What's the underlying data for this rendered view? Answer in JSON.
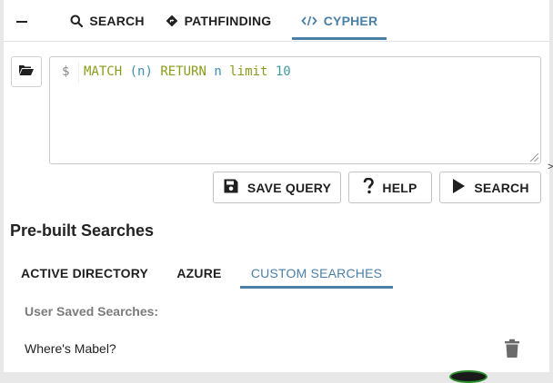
{
  "top_tabs": [
    {
      "label": "SEARCH",
      "icon": "search-icon"
    },
    {
      "label": "PATHFINDING",
      "icon": "diamond-route-icon"
    },
    {
      "label": "CYPHER",
      "icon": "code-icon",
      "active": true
    }
  ],
  "collapse_icon": "minus-icon",
  "editor": {
    "prompt": "$",
    "query": {
      "match": "MATCH",
      "open_paren": "(",
      "var1": "n",
      "close_paren": ")",
      "return": "RETURN",
      "var2": "n",
      "limit": "limit",
      "number": "10"
    }
  },
  "buttons": {
    "save_query": "SAVE QUERY",
    "help": "HELP",
    "search": "SEARCH"
  },
  "prebuilt": {
    "title": "Pre-built Searches",
    "tabs": [
      {
        "label": "ACTIVE DIRECTORY"
      },
      {
        "label": "AZURE"
      },
      {
        "label": "CUSTOM SEARCHES",
        "active": true
      }
    ],
    "saved_label": "User Saved Searches:",
    "saved_items": [
      {
        "name": "Where's Mabel?"
      }
    ]
  },
  "colors": {
    "accent": "#4a7fa6",
    "keyword": "#8a9c1a",
    "number": "#3f9aa0"
  }
}
